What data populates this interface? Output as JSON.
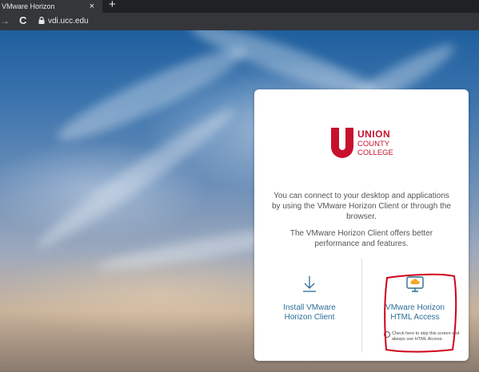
{
  "browser": {
    "tab_title": "VMware Horizon",
    "tab_close": "×",
    "new_tab": "+",
    "back_icon": "→",
    "reload_icon": "C",
    "url": "vdi.ucc.edu"
  },
  "logo": {
    "line1": "UNION",
    "line2": "COUNTY",
    "line3": "COLLEGE",
    "brand_color": "#c8102e"
  },
  "card": {
    "message1": "You can connect to your desktop and applications by using the VMware Horizon Client or through the browser.",
    "message2": "The VMware Horizon Client offers better performance and features.",
    "install_label_1": "Install VMware",
    "install_label_2": "Horizon Client",
    "html_label_1": "VMware Horizon",
    "html_label_2": "HTML Access",
    "skip_text": "Check here to skip this screen and always use HTML Access.",
    "link_color": "#2b6e98"
  },
  "icons": {
    "install": "download-arrow-icon",
    "html": "monitor-cloud-icon"
  },
  "annotation_color": "#d0021b"
}
